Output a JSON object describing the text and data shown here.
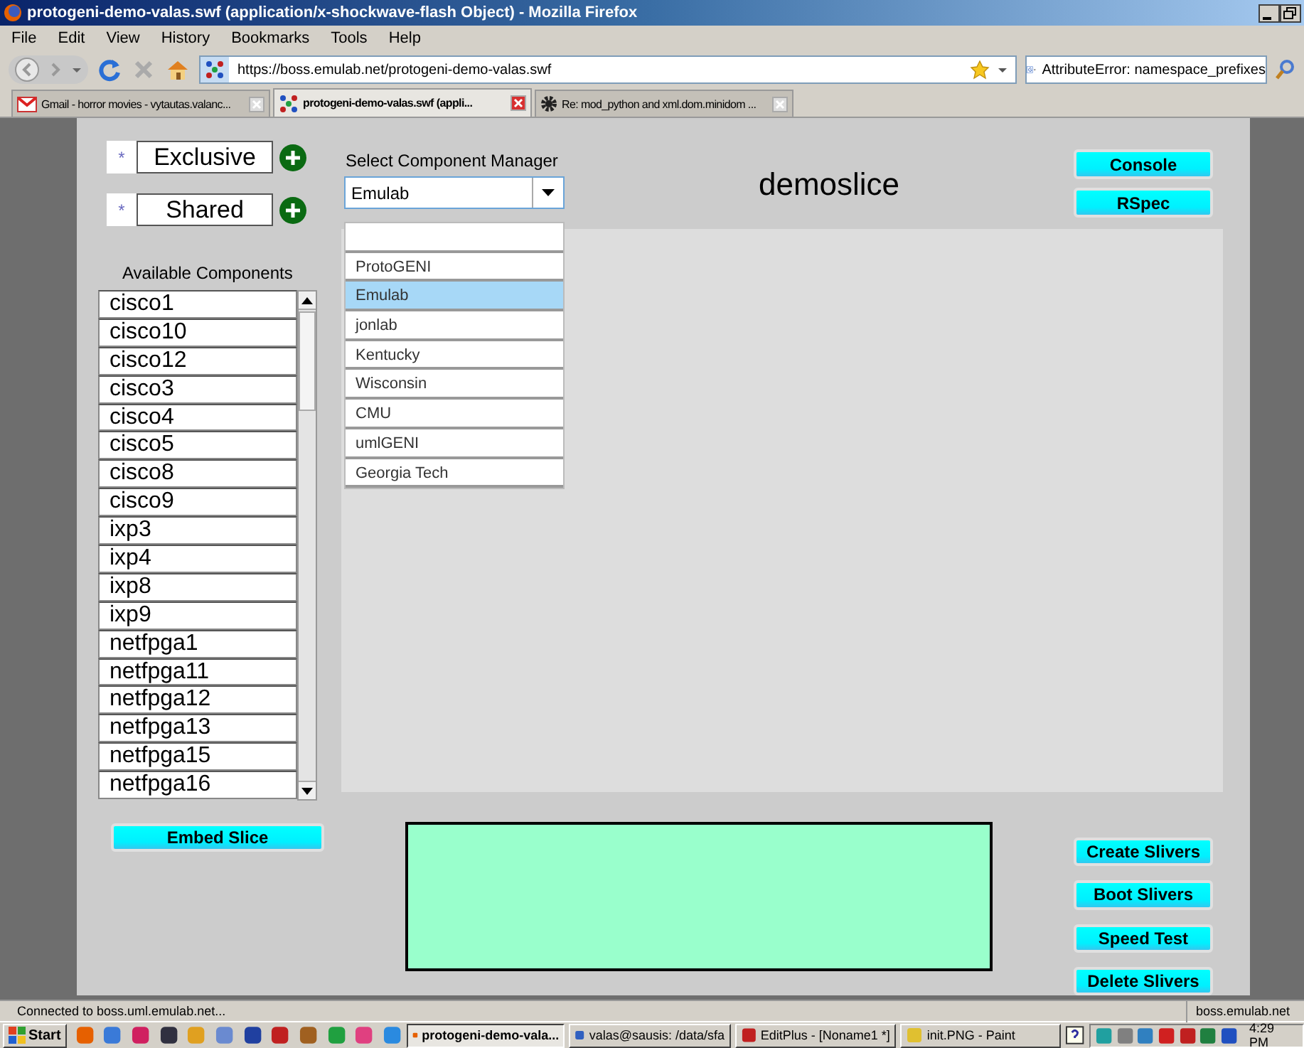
{
  "window": {
    "title": "protogeni-demo-valas.swf (application/x-shockwave-flash Object) - Mozilla Firefox"
  },
  "menu": [
    "File",
    "Edit",
    "View",
    "History",
    "Bookmarks",
    "Tools",
    "Help"
  ],
  "address_bar": {
    "value": "https://boss.emulab.net/protogeni-demo-valas.swf"
  },
  "search_field": {
    "value": "AttributeError: namespace_prefixes"
  },
  "tabs": [
    {
      "label": "Gmail - horror movies - vytautas.valanc...",
      "selected": false,
      "kind": "mail"
    },
    {
      "label": "protogeni-demo-valas.swf (appli...",
      "selected": true,
      "kind": "site"
    },
    {
      "label": "Re: mod_python and xml.dom.minidom ...",
      "selected": false,
      "kind": "gear"
    }
  ],
  "app": {
    "node_types": [
      {
        "mark": "*",
        "label": "Exclusive"
      },
      {
        "mark": "*",
        "label": "Shared"
      }
    ],
    "components_title": "Available Components",
    "components": [
      "cisco1",
      "cisco10",
      "cisco12",
      "cisco3",
      "cisco4",
      "cisco5",
      "cisco8",
      "cisco9",
      "ixp3",
      "ixp4",
      "ixp8",
      "ixp9",
      "netfpga1",
      "netfpga11",
      "netfpga12",
      "netfpga13",
      "netfpga15",
      "netfpga16"
    ],
    "manager_label": "Select Component Manager",
    "manager_value": "Emulab",
    "manager_options": [
      {
        "label": "ProtoGENI",
        "selected": false
      },
      {
        "label": "Emulab",
        "selected": true
      },
      {
        "label": "jonlab",
        "selected": false
      },
      {
        "label": "Kentucky",
        "selected": false
      },
      {
        "label": "Wisconsin",
        "selected": false
      },
      {
        "label": "CMU",
        "selected": false
      },
      {
        "label": "umlGENI",
        "selected": false
      },
      {
        "label": "Georgia Tech",
        "selected": false
      }
    ],
    "slice_name": "demoslice",
    "top_buttons": [
      "Console",
      "RSpec"
    ],
    "embed_button": "Embed Slice",
    "actions": [
      "Create Slivers",
      "Boot Slivers",
      "Speed Test",
      "Delete Slivers"
    ]
  },
  "status_bar": {
    "text": "Connected to boss.uml.emulab.net...",
    "host": "boss.emulab.net"
  },
  "taskbar": {
    "start": "Start",
    "tasks": [
      {
        "label": "protogeni-demo-vala...",
        "selected": true
      },
      {
        "label": "valas@sausis: /data/sfa",
        "selected": false
      },
      {
        "label": "EditPlus - [Noname1 *]",
        "selected": false
      },
      {
        "label": "init.PNG - Paint",
        "selected": false
      }
    ],
    "clock": "4:29 PM"
  }
}
